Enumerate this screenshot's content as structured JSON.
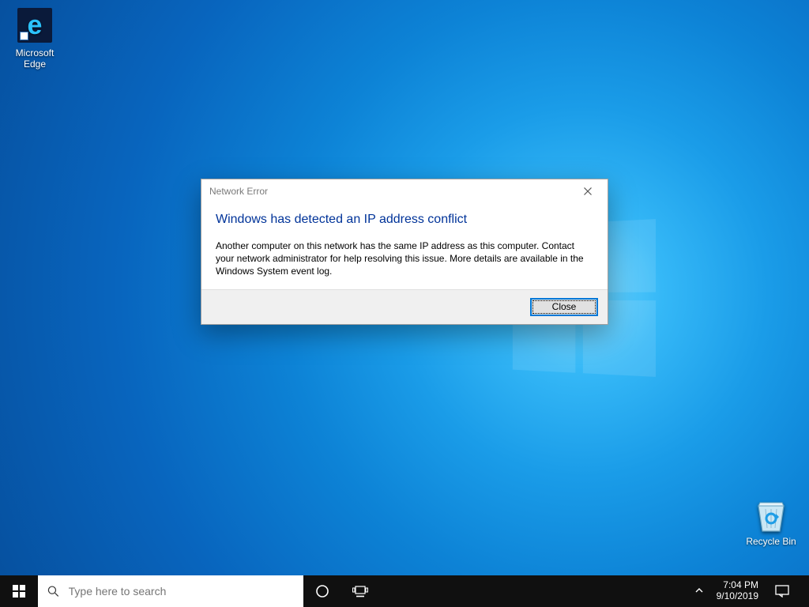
{
  "desktop": {
    "icons": {
      "edge_label": "Microsoft Edge",
      "recycle_label": "Recycle Bin"
    }
  },
  "dialog": {
    "title": "Network Error",
    "headline": "Windows has detected an IP address conflict",
    "message": "Another computer on this network has the same IP address as this computer. Contact your network administrator for help resolving this issue. More details are available in the Windows System event log.",
    "close_button": "Close"
  },
  "taskbar": {
    "search_placeholder": "Type here to search",
    "clock_time": "7:04 PM",
    "clock_date": "9/10/2019"
  }
}
